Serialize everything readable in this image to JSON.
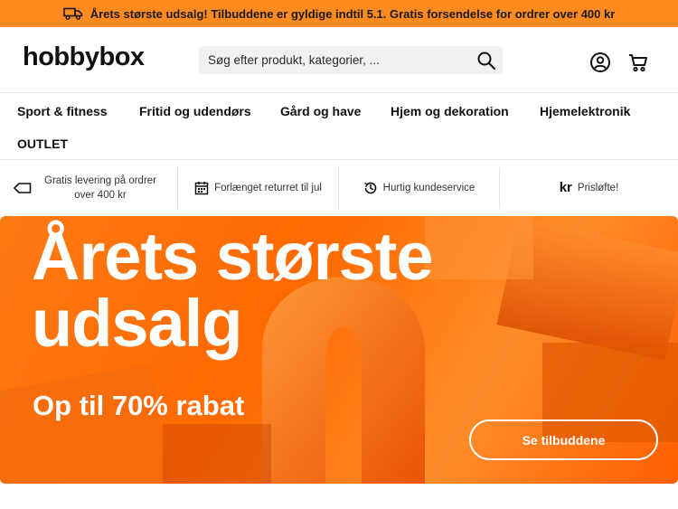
{
  "topbar": {
    "message": "Årets største udsalg! Tilbuddene er gyldige indtil 5.1. Gratis forsendelse for ordrer over 400 kr",
    "icon": "truck-icon"
  },
  "header": {
    "logo": "hobbybox",
    "search_placeholder": "Søg efter produkt, kategorier, ...",
    "icons": [
      "search-icon",
      "account-icon",
      "cart-icon"
    ]
  },
  "nav": {
    "items": [
      "Sport & fitness",
      "Fritid og udendørs",
      "Gård og have",
      "Hjem og dekoration",
      "Hjemelektronik",
      "OUTLET"
    ]
  },
  "usp": {
    "items": [
      {
        "icon": "tag-icon",
        "text": "Gratis levering på ordrer over 400 kr"
      },
      {
        "icon": "calendar-icon",
        "text": "Forlænget returret til jul"
      },
      {
        "icon": "clock-icon",
        "text": "Hurtig kundeservice"
      },
      {
        "icon": "kr-icon",
        "symbol": "kr",
        "text": "Prisløfte!"
      }
    ]
  },
  "hero": {
    "title": "Årets største udsalg",
    "subtitle": "Op til 70% rabat",
    "cta": "Se tilbuddene"
  },
  "colors": {
    "accent": "#ff8a1f",
    "hero_bg": "#ff6a00",
    "text": "#111111"
  }
}
